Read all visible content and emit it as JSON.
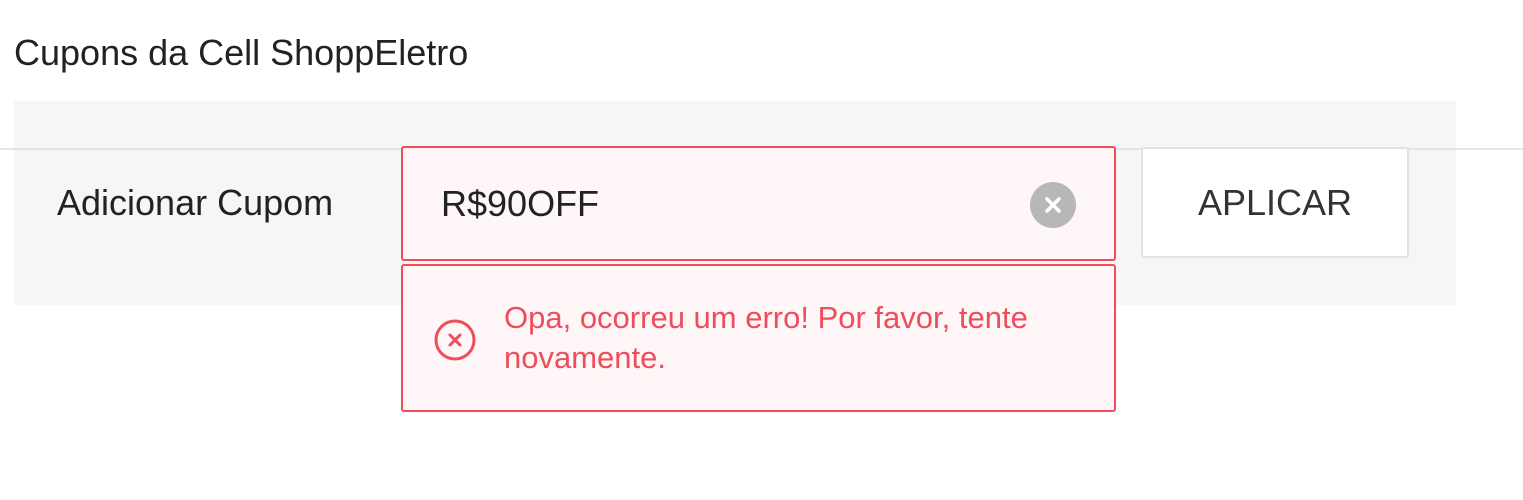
{
  "section": {
    "title": "Cupons da Cell ShoppEletro"
  },
  "coupon": {
    "label": "Adicionar Cupom",
    "input_value": "R$90OFF",
    "clear_icon": "clear-circle-icon",
    "apply_label": "APLICAR"
  },
  "error": {
    "icon": "error-circle-x-icon",
    "message": "Opa, ocorreu um erro! Por favor, tente novamente."
  },
  "colors": {
    "error": "#ee4d5b",
    "error_bg": "#fff7f7",
    "panel_bg": "#f6f6f6",
    "clear_icon_bg": "#b7b7b7"
  }
}
